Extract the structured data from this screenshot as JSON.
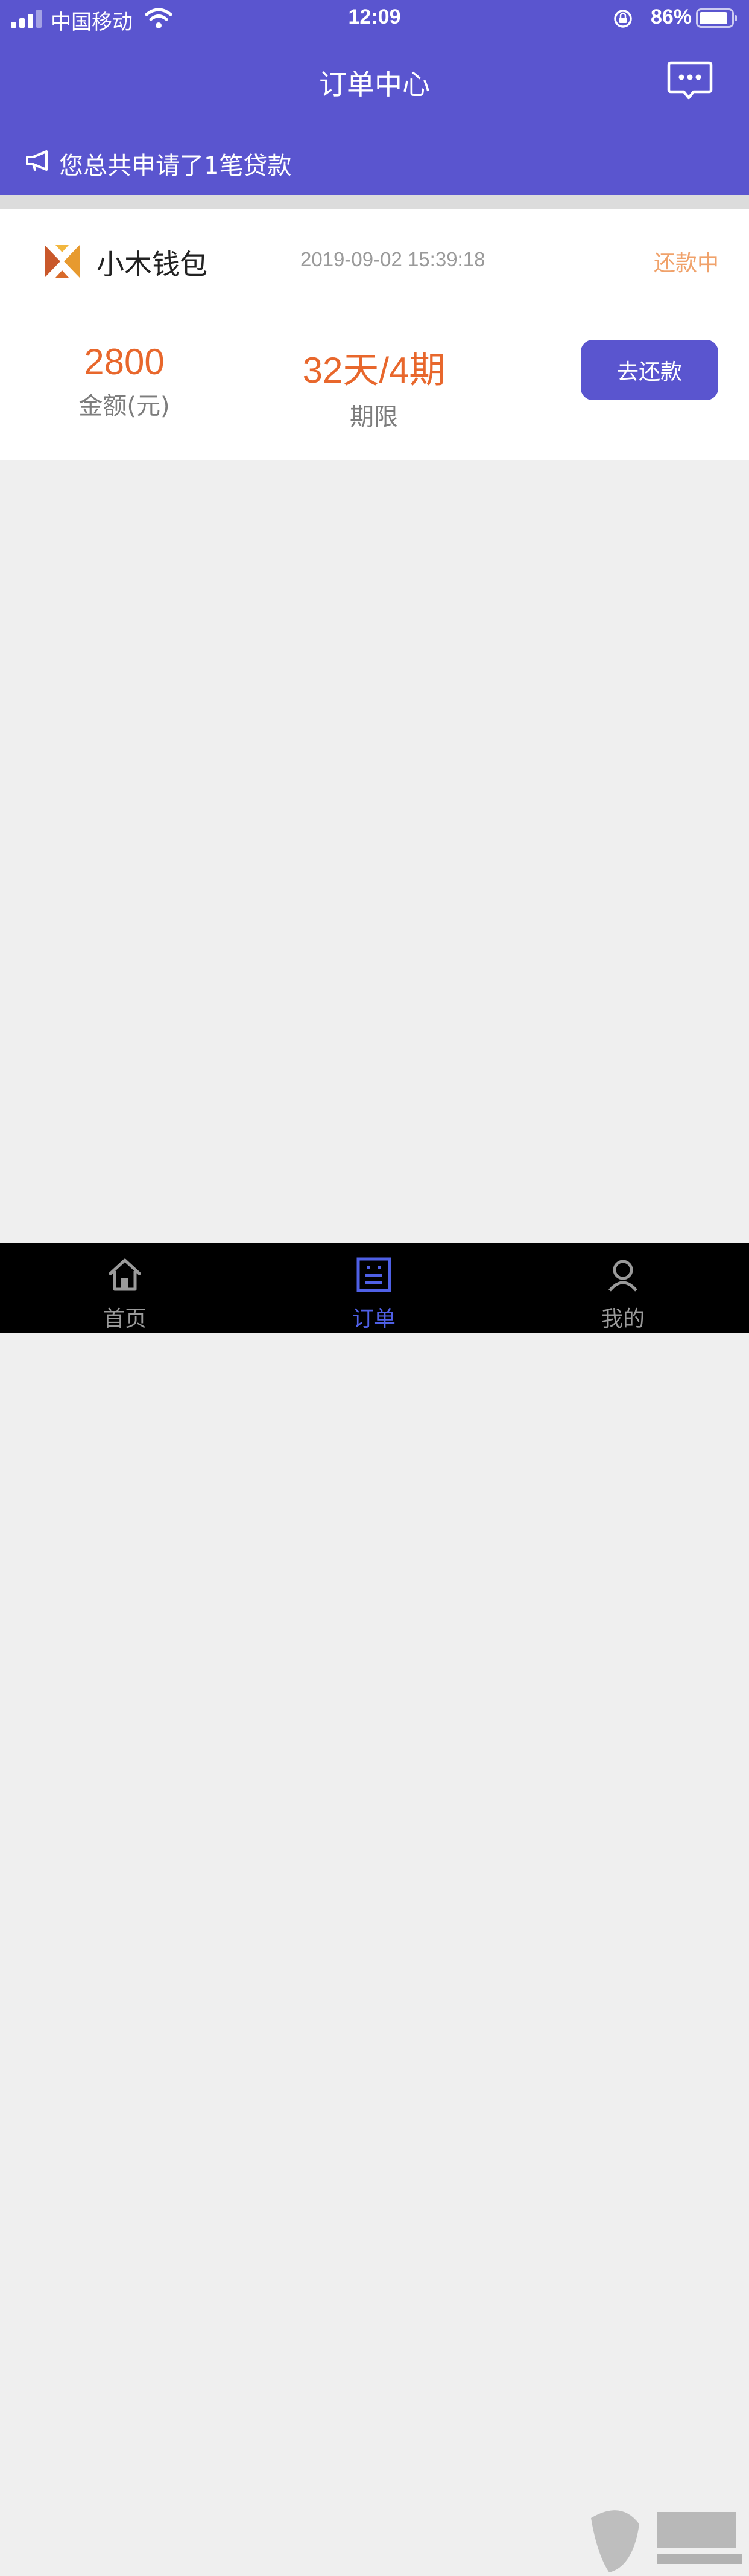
{
  "status_bar": {
    "carrier": "中国移动",
    "time": "12:09",
    "battery": "86%"
  },
  "header": {
    "title": "订单中心",
    "message_icon": "message-bubble-icon",
    "notice": "您总共申请了1笔贷款"
  },
  "order": {
    "app_name": "小木钱包",
    "datetime": "2019-09-02 15:39:18",
    "status": "还款中",
    "amount": "2800",
    "amount_label": "金额(元)",
    "term": "32天/4期",
    "term_label": "期限",
    "repay_button": "去还款"
  },
  "tabbar": {
    "tabs": [
      {
        "label": "首页",
        "icon": "home-icon"
      },
      {
        "label": "订单",
        "icon": "order-icon",
        "active": true
      },
      {
        "label": "我的",
        "icon": "user-icon"
      }
    ]
  },
  "colors": {
    "brand": "#5a55cf",
    "accent": "#e8672c",
    "status": "#f0a26b",
    "tab_active": "#4f60e6"
  }
}
